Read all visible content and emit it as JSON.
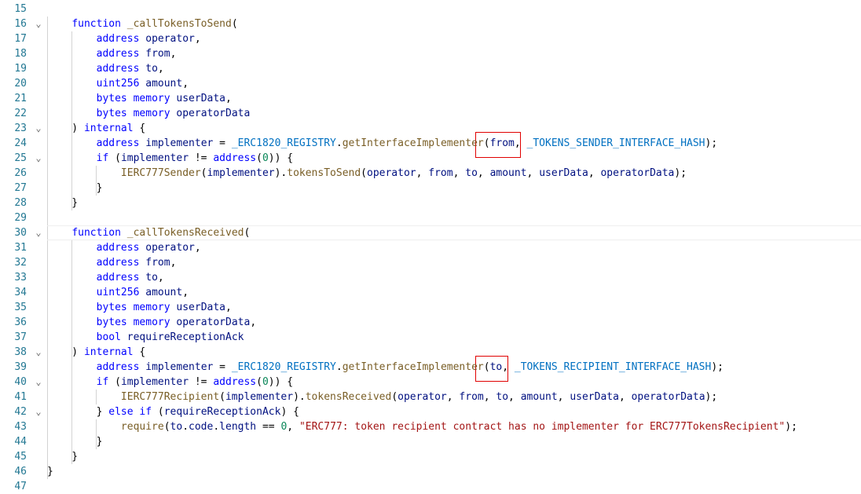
{
  "editor": {
    "colors": {
      "keyword": "#0000ff",
      "function": "#795e26",
      "identifier": "#001080",
      "number": "#098658",
      "string": "#a31515",
      "constant": "#0070c1",
      "line_number": "#237893",
      "highlight_box": "#e00000"
    },
    "lines": [
      {
        "num": "15",
        "fold": "",
        "tokens": []
      },
      {
        "num": "16",
        "fold": "chevron-down",
        "tokens": [
          {
            "t": "    ",
            "c": "plain"
          },
          {
            "t": "function",
            "c": "kw"
          },
          {
            "t": " ",
            "c": "plain"
          },
          {
            "t": "_callTokensToSend",
            "c": "fn"
          },
          {
            "t": "(",
            "c": "plain"
          }
        ]
      },
      {
        "num": "17",
        "fold": "",
        "tokens": [
          {
            "t": "        ",
            "c": "plain"
          },
          {
            "t": "address",
            "c": "kw"
          },
          {
            "t": " ",
            "c": "plain"
          },
          {
            "t": "operator",
            "c": "id"
          },
          {
            "t": ",",
            "c": "plain"
          }
        ]
      },
      {
        "num": "18",
        "fold": "",
        "tokens": [
          {
            "t": "        ",
            "c": "plain"
          },
          {
            "t": "address",
            "c": "kw"
          },
          {
            "t": " ",
            "c": "plain"
          },
          {
            "t": "from",
            "c": "id"
          },
          {
            "t": ",",
            "c": "plain"
          }
        ]
      },
      {
        "num": "19",
        "fold": "",
        "tokens": [
          {
            "t": "        ",
            "c": "plain"
          },
          {
            "t": "address",
            "c": "kw"
          },
          {
            "t": " ",
            "c": "plain"
          },
          {
            "t": "to",
            "c": "id"
          },
          {
            "t": ",",
            "c": "plain"
          }
        ]
      },
      {
        "num": "20",
        "fold": "",
        "tokens": [
          {
            "t": "        ",
            "c": "plain"
          },
          {
            "t": "uint256",
            "c": "kw"
          },
          {
            "t": " ",
            "c": "plain"
          },
          {
            "t": "amount",
            "c": "id"
          },
          {
            "t": ",",
            "c": "plain"
          }
        ]
      },
      {
        "num": "21",
        "fold": "",
        "tokens": [
          {
            "t": "        ",
            "c": "plain"
          },
          {
            "t": "bytes",
            "c": "kw"
          },
          {
            "t": " ",
            "c": "plain"
          },
          {
            "t": "memory",
            "c": "kw"
          },
          {
            "t": " ",
            "c": "plain"
          },
          {
            "t": "userData",
            "c": "id"
          },
          {
            "t": ",",
            "c": "plain"
          }
        ]
      },
      {
        "num": "22",
        "fold": "",
        "tokens": [
          {
            "t": "        ",
            "c": "plain"
          },
          {
            "t": "bytes",
            "c": "kw"
          },
          {
            "t": " ",
            "c": "plain"
          },
          {
            "t": "memory",
            "c": "kw"
          },
          {
            "t": " ",
            "c": "plain"
          },
          {
            "t": "operatorData",
            "c": "id"
          }
        ]
      },
      {
        "num": "23",
        "fold": "chevron-down",
        "tokens": [
          {
            "t": "    ) ",
            "c": "plain"
          },
          {
            "t": "internal",
            "c": "kw"
          },
          {
            "t": " {",
            "c": "plain"
          }
        ]
      },
      {
        "num": "24",
        "fold": "",
        "tokens": [
          {
            "t": "        ",
            "c": "plain"
          },
          {
            "t": "address",
            "c": "kw"
          },
          {
            "t": " ",
            "c": "plain"
          },
          {
            "t": "implementer",
            "c": "id"
          },
          {
            "t": " = ",
            "c": "plain"
          },
          {
            "t": "_ERC1820_REGISTRY",
            "c": "const"
          },
          {
            "t": ".",
            "c": "plain"
          },
          {
            "t": "getInterfaceImplementer",
            "c": "fn"
          },
          {
            "t": "(",
            "c": "plain"
          },
          {
            "t": "from",
            "c": "id"
          },
          {
            "t": ", ",
            "c": "plain"
          },
          {
            "t": "_TOKENS_SENDER_INTERFACE_HASH",
            "c": "const"
          },
          {
            "t": ");",
            "c": "plain"
          }
        ]
      },
      {
        "num": "25",
        "fold": "chevron-down",
        "tokens": [
          {
            "t": "        ",
            "c": "plain"
          },
          {
            "t": "if",
            "c": "kw"
          },
          {
            "t": " (",
            "c": "plain"
          },
          {
            "t": "implementer",
            "c": "id"
          },
          {
            "t": " != ",
            "c": "plain"
          },
          {
            "t": "address",
            "c": "kw"
          },
          {
            "t": "(",
            "c": "plain"
          },
          {
            "t": "0",
            "c": "num"
          },
          {
            "t": ")) {",
            "c": "plain"
          }
        ]
      },
      {
        "num": "26",
        "fold": "",
        "tokens": [
          {
            "t": "            ",
            "c": "plain"
          },
          {
            "t": "IERC777Sender",
            "c": "fn"
          },
          {
            "t": "(",
            "c": "plain"
          },
          {
            "t": "implementer",
            "c": "id"
          },
          {
            "t": ").",
            "c": "plain"
          },
          {
            "t": "tokensToSend",
            "c": "fn"
          },
          {
            "t": "(",
            "c": "plain"
          },
          {
            "t": "operator",
            "c": "id"
          },
          {
            "t": ", ",
            "c": "plain"
          },
          {
            "t": "from",
            "c": "id"
          },
          {
            "t": ", ",
            "c": "plain"
          },
          {
            "t": "to",
            "c": "id"
          },
          {
            "t": ", ",
            "c": "plain"
          },
          {
            "t": "amount",
            "c": "id"
          },
          {
            "t": ", ",
            "c": "plain"
          },
          {
            "t": "userData",
            "c": "id"
          },
          {
            "t": ", ",
            "c": "plain"
          },
          {
            "t": "operatorData",
            "c": "id"
          },
          {
            "t": ");",
            "c": "plain"
          }
        ]
      },
      {
        "num": "27",
        "fold": "",
        "tokens": [
          {
            "t": "        }",
            "c": "plain"
          }
        ]
      },
      {
        "num": "28",
        "fold": "",
        "tokens": [
          {
            "t": "    }",
            "c": "plain"
          }
        ]
      },
      {
        "num": "29",
        "fold": "",
        "tokens": []
      },
      {
        "num": "30",
        "fold": "chevron-down",
        "tokens": [
          {
            "t": "    ",
            "c": "plain"
          },
          {
            "t": "function",
            "c": "kw"
          },
          {
            "t": " ",
            "c": "plain"
          },
          {
            "t": "_callTokensReceived",
            "c": "fn"
          },
          {
            "t": "(",
            "c": "plain"
          }
        ]
      },
      {
        "num": "31",
        "fold": "",
        "tokens": [
          {
            "t": "        ",
            "c": "plain"
          },
          {
            "t": "address",
            "c": "kw"
          },
          {
            "t": " ",
            "c": "plain"
          },
          {
            "t": "operator",
            "c": "id"
          },
          {
            "t": ",",
            "c": "plain"
          }
        ]
      },
      {
        "num": "32",
        "fold": "",
        "tokens": [
          {
            "t": "        ",
            "c": "plain"
          },
          {
            "t": "address",
            "c": "kw"
          },
          {
            "t": " ",
            "c": "plain"
          },
          {
            "t": "from",
            "c": "id"
          },
          {
            "t": ",",
            "c": "plain"
          }
        ]
      },
      {
        "num": "33",
        "fold": "",
        "tokens": [
          {
            "t": "        ",
            "c": "plain"
          },
          {
            "t": "address",
            "c": "kw"
          },
          {
            "t": " ",
            "c": "plain"
          },
          {
            "t": "to",
            "c": "id"
          },
          {
            "t": ",",
            "c": "plain"
          }
        ]
      },
      {
        "num": "34",
        "fold": "",
        "tokens": [
          {
            "t": "        ",
            "c": "plain"
          },
          {
            "t": "uint256",
            "c": "kw"
          },
          {
            "t": " ",
            "c": "plain"
          },
          {
            "t": "amount",
            "c": "id"
          },
          {
            "t": ",",
            "c": "plain"
          }
        ]
      },
      {
        "num": "35",
        "fold": "",
        "tokens": [
          {
            "t": "        ",
            "c": "plain"
          },
          {
            "t": "bytes",
            "c": "kw"
          },
          {
            "t": " ",
            "c": "plain"
          },
          {
            "t": "memory",
            "c": "kw"
          },
          {
            "t": " ",
            "c": "plain"
          },
          {
            "t": "userData",
            "c": "id"
          },
          {
            "t": ",",
            "c": "plain"
          }
        ]
      },
      {
        "num": "36",
        "fold": "",
        "tokens": [
          {
            "t": "        ",
            "c": "plain"
          },
          {
            "t": "bytes",
            "c": "kw"
          },
          {
            "t": " ",
            "c": "plain"
          },
          {
            "t": "memory",
            "c": "kw"
          },
          {
            "t": " ",
            "c": "plain"
          },
          {
            "t": "operatorData",
            "c": "id"
          },
          {
            "t": ",",
            "c": "plain"
          }
        ]
      },
      {
        "num": "37",
        "fold": "",
        "tokens": [
          {
            "t": "        ",
            "c": "plain"
          },
          {
            "t": "bool",
            "c": "kw"
          },
          {
            "t": " ",
            "c": "plain"
          },
          {
            "t": "requireReceptionAck",
            "c": "id"
          }
        ]
      },
      {
        "num": "38",
        "fold": "chevron-down",
        "tokens": [
          {
            "t": "    ) ",
            "c": "plain"
          },
          {
            "t": "internal",
            "c": "kw"
          },
          {
            "t": " {",
            "c": "plain"
          }
        ]
      },
      {
        "num": "39",
        "fold": "",
        "tokens": [
          {
            "t": "        ",
            "c": "plain"
          },
          {
            "t": "address",
            "c": "kw"
          },
          {
            "t": " ",
            "c": "plain"
          },
          {
            "t": "implementer",
            "c": "id"
          },
          {
            "t": " = ",
            "c": "plain"
          },
          {
            "t": "_ERC1820_REGISTRY",
            "c": "const"
          },
          {
            "t": ".",
            "c": "plain"
          },
          {
            "t": "getInterfaceImplementer",
            "c": "fn"
          },
          {
            "t": "(",
            "c": "plain"
          },
          {
            "t": "to",
            "c": "id"
          },
          {
            "t": ", ",
            "c": "plain"
          },
          {
            "t": "_TOKENS_RECIPIENT_INTERFACE_HASH",
            "c": "const"
          },
          {
            "t": ");",
            "c": "plain"
          }
        ]
      },
      {
        "num": "40",
        "fold": "chevron-down",
        "tokens": [
          {
            "t": "        ",
            "c": "plain"
          },
          {
            "t": "if",
            "c": "kw"
          },
          {
            "t": " (",
            "c": "plain"
          },
          {
            "t": "implementer",
            "c": "id"
          },
          {
            "t": " != ",
            "c": "plain"
          },
          {
            "t": "address",
            "c": "kw"
          },
          {
            "t": "(",
            "c": "plain"
          },
          {
            "t": "0",
            "c": "num"
          },
          {
            "t": ")) {",
            "c": "plain"
          }
        ]
      },
      {
        "num": "41",
        "fold": "",
        "tokens": [
          {
            "t": "            ",
            "c": "plain"
          },
          {
            "t": "IERC777Recipient",
            "c": "fn"
          },
          {
            "t": "(",
            "c": "plain"
          },
          {
            "t": "implementer",
            "c": "id"
          },
          {
            "t": ").",
            "c": "plain"
          },
          {
            "t": "tokensReceived",
            "c": "fn"
          },
          {
            "t": "(",
            "c": "plain"
          },
          {
            "t": "operator",
            "c": "id"
          },
          {
            "t": ", ",
            "c": "plain"
          },
          {
            "t": "from",
            "c": "id"
          },
          {
            "t": ", ",
            "c": "plain"
          },
          {
            "t": "to",
            "c": "id"
          },
          {
            "t": ", ",
            "c": "plain"
          },
          {
            "t": "amount",
            "c": "id"
          },
          {
            "t": ", ",
            "c": "plain"
          },
          {
            "t": "userData",
            "c": "id"
          },
          {
            "t": ", ",
            "c": "plain"
          },
          {
            "t": "operatorData",
            "c": "id"
          },
          {
            "t": ");",
            "c": "plain"
          }
        ]
      },
      {
        "num": "42",
        "fold": "chevron-down",
        "tokens": [
          {
            "t": "        } ",
            "c": "plain"
          },
          {
            "t": "else",
            "c": "kw"
          },
          {
            "t": " ",
            "c": "plain"
          },
          {
            "t": "if",
            "c": "kw"
          },
          {
            "t": " (",
            "c": "plain"
          },
          {
            "t": "requireReceptionAck",
            "c": "id"
          },
          {
            "t": ") {",
            "c": "plain"
          }
        ]
      },
      {
        "num": "43",
        "fold": "",
        "tokens": [
          {
            "t": "            ",
            "c": "plain"
          },
          {
            "t": "require",
            "c": "fn"
          },
          {
            "t": "(",
            "c": "plain"
          },
          {
            "t": "to",
            "c": "id"
          },
          {
            "t": ".",
            "c": "plain"
          },
          {
            "t": "code",
            "c": "id"
          },
          {
            "t": ".",
            "c": "plain"
          },
          {
            "t": "length",
            "c": "id"
          },
          {
            "t": " == ",
            "c": "plain"
          },
          {
            "t": "0",
            "c": "num"
          },
          {
            "t": ", ",
            "c": "plain"
          },
          {
            "t": "\"ERC777: token recipient contract has no implementer for ERC777TokensRecipient\"",
            "c": "str"
          },
          {
            "t": ");",
            "c": "plain"
          }
        ]
      },
      {
        "num": "44",
        "fold": "",
        "tokens": [
          {
            "t": "        }",
            "c": "plain"
          }
        ]
      },
      {
        "num": "45",
        "fold": "",
        "tokens": [
          {
            "t": "    }",
            "c": "plain"
          }
        ]
      },
      {
        "num": "46",
        "fold": "",
        "tokens": [
          {
            "t": "}",
            "c": "plain"
          }
        ]
      },
      {
        "num": "47",
        "fold": "",
        "tokens": []
      }
    ]
  }
}
